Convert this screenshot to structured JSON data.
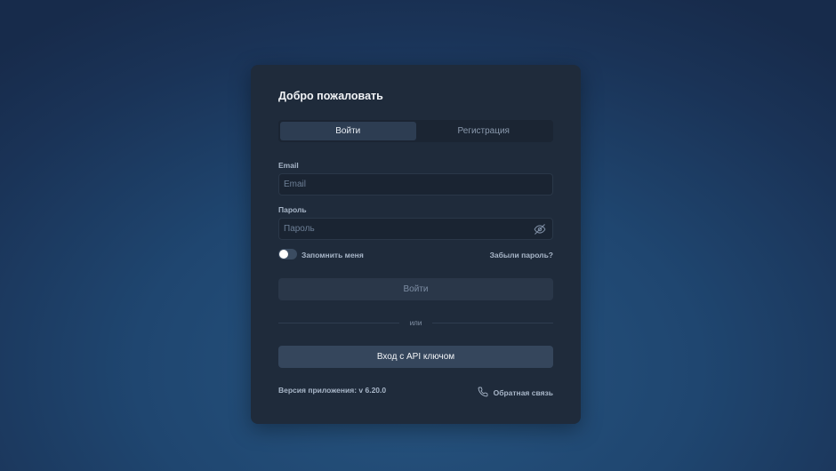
{
  "card": {
    "title": "Добро пожаловать"
  },
  "tabs": [
    {
      "label": "Войти",
      "active": true
    },
    {
      "label": "Регистрация",
      "active": false
    }
  ],
  "form": {
    "email_label": "Email",
    "email_placeholder": "Email",
    "password_label": "Пароль",
    "password_placeholder": "Пароль",
    "remember_label": "Запомнить меня",
    "remember_checked": false,
    "forgot_label": "Забыли пароль?",
    "submit_label": "Войти",
    "divider_label": "или",
    "api_label": "Вход с API ключом"
  },
  "footer": {
    "version": "Версия приложения: v 6.20.0",
    "feedback_label": "Обратная связь",
    "feedback_icon": "phone-icon"
  },
  "icons": {
    "password_toggle": "eye-off-icon"
  },
  "colors": {
    "card_bg": "#1f2b3b",
    "accent_tab": "#2d3d52",
    "api_button": "#35465c"
  }
}
